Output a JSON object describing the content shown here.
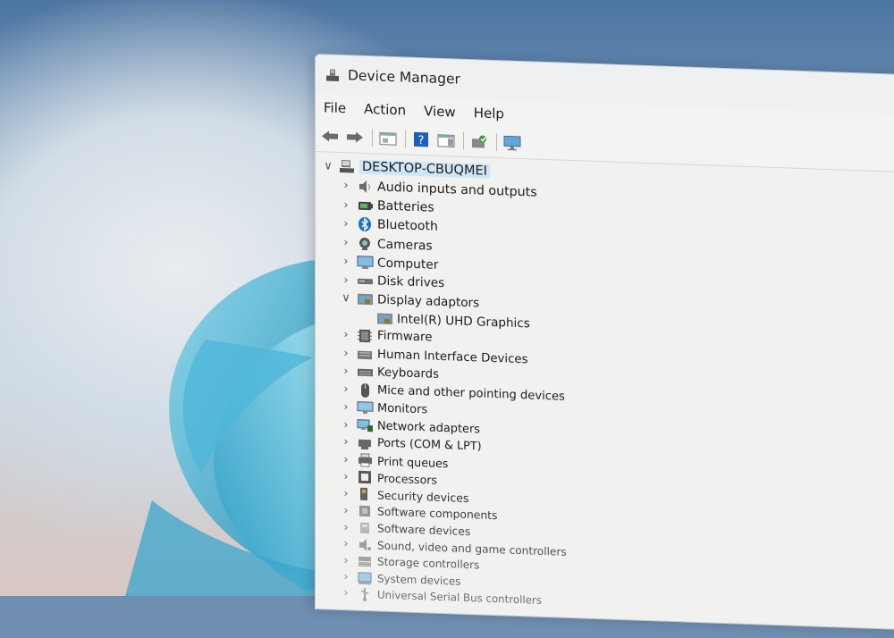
{
  "window": {
    "title": "Device Manager"
  },
  "menu": [
    "File",
    "Action",
    "View",
    "Help"
  ],
  "toolbar": [
    "back-arrow-icon",
    "forward-arrow-icon",
    "properties-icon",
    "help-icon",
    "show-hide-icon",
    "update-driver-icon",
    "monitor-icon"
  ],
  "tree": {
    "root": "DESKTOP-CBUQMEI",
    "categories": [
      {
        "label": "Audio inputs and outputs",
        "icon": "speaker-icon",
        "expanded": false
      },
      {
        "label": "Batteries",
        "icon": "battery-icon",
        "expanded": false
      },
      {
        "label": "Bluetooth",
        "icon": "bluetooth-icon",
        "expanded": false
      },
      {
        "label": "Cameras",
        "icon": "camera-icon",
        "expanded": false
      },
      {
        "label": "Computer",
        "icon": "computer-icon",
        "expanded": false
      },
      {
        "label": "Disk drives",
        "icon": "disk-drive-icon",
        "expanded": false
      },
      {
        "label": "Display adaptors",
        "icon": "display-adapter-icon",
        "expanded": true,
        "children": [
          "Intel(R) UHD Graphics"
        ]
      },
      {
        "label": "Firmware",
        "icon": "firmware-icon",
        "expanded": false
      },
      {
        "label": "Human Interface Devices",
        "icon": "hid-icon",
        "expanded": false
      },
      {
        "label": "Keyboards",
        "icon": "keyboard-icon",
        "expanded": false
      },
      {
        "label": "Mice and other pointing devices",
        "icon": "mouse-icon",
        "expanded": false
      },
      {
        "label": "Monitors",
        "icon": "monitor-icon",
        "expanded": false
      },
      {
        "label": "Network adapters",
        "icon": "network-icon",
        "expanded": false
      },
      {
        "label": "Ports (COM & LPT)",
        "icon": "port-icon",
        "expanded": false
      },
      {
        "label": "Print queues",
        "icon": "printer-icon",
        "expanded": false
      },
      {
        "label": "Processors",
        "icon": "processor-icon",
        "expanded": false
      },
      {
        "label": "Security devices",
        "icon": "security-icon",
        "expanded": false
      },
      {
        "label": "Software components",
        "icon": "software-component-icon",
        "expanded": false
      },
      {
        "label": "Software devices",
        "icon": "software-device-icon",
        "expanded": false
      },
      {
        "label": "Sound, video and game controllers",
        "icon": "sound-icon",
        "expanded": false
      },
      {
        "label": "Storage controllers",
        "icon": "storage-icon",
        "expanded": false
      },
      {
        "label": "System devices",
        "icon": "system-icon",
        "expanded": false
      },
      {
        "label": "Universal Serial Bus controllers",
        "icon": "usb-icon",
        "expanded": false
      }
    ]
  },
  "colors": {
    "selection": "#cfe6f7",
    "accent": "#1a73c9"
  }
}
